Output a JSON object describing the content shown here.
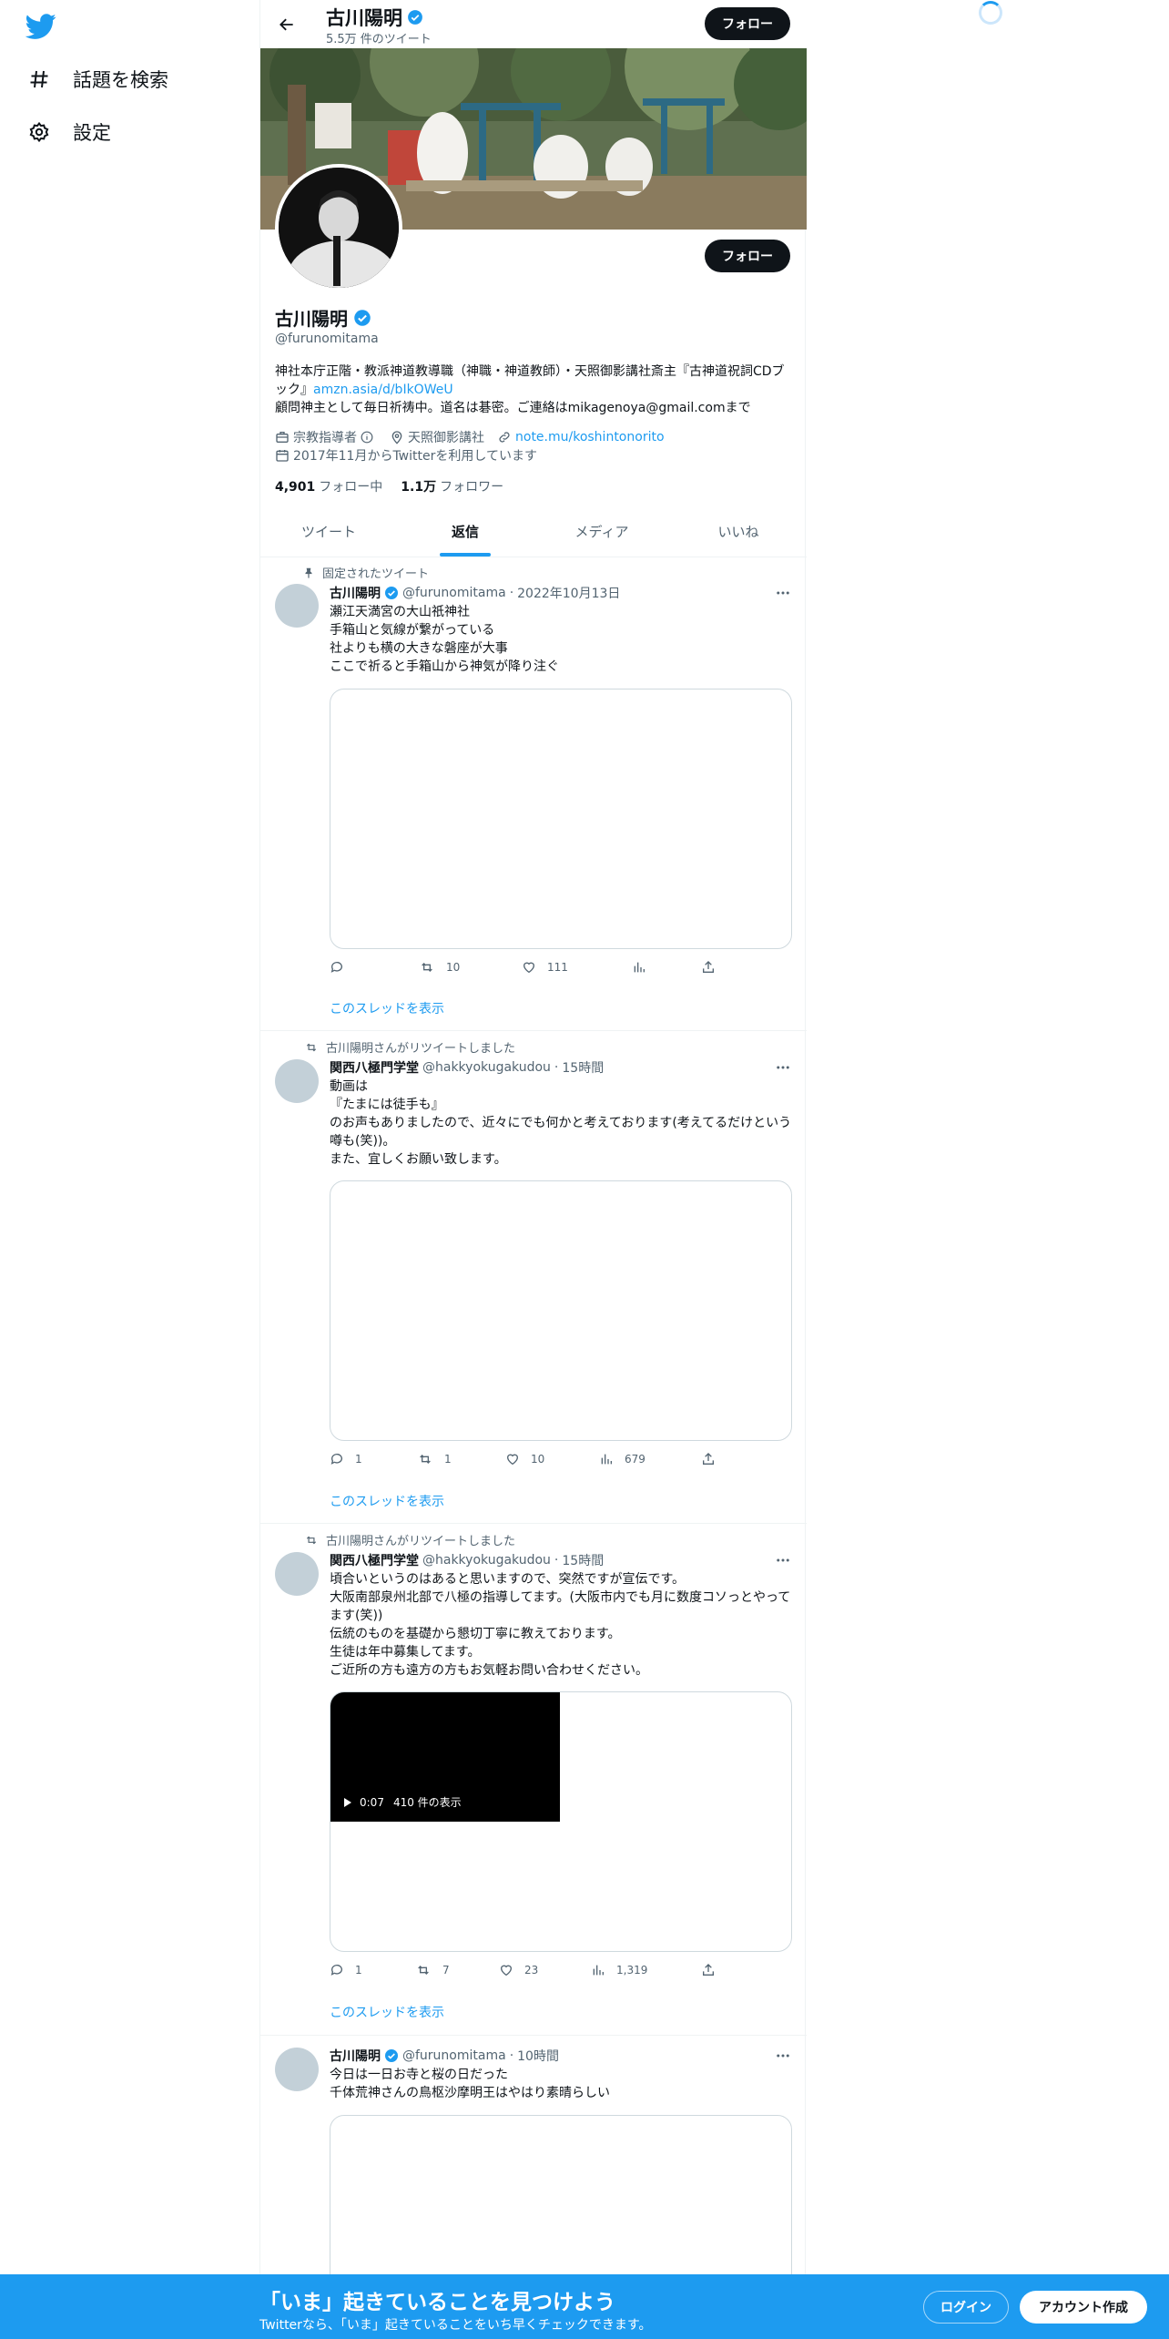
{
  "nav": {
    "items": [
      {
        "label": "話題を検索",
        "icon": "hashtag-icon"
      },
      {
        "label": "設定",
        "icon": "gear-icon"
      }
    ]
  },
  "header": {
    "name": "古川陽明",
    "tweet_count": "5.5万 件のツイート",
    "follow_label": "フォロー"
  },
  "profile": {
    "name": "古川陽明",
    "handle": "@furunomitama",
    "bio_line1": "神社本庁正階・教派神道教導職（神職・神道教師）・天照御影講社斎主『古神道祝詞CDブック』",
    "bio_link": "amzn.asia/d/bIkOWeU",
    "bio_line2": "顧問神主として毎日祈祷中。道名は碁密。ご連絡はmikagenoya@gmail.comまで",
    "category": "宗教指導者",
    "location": "天照御影講社",
    "website": "note.mu/koshintonorito",
    "joined": "2017年11月からTwitterを利用しています",
    "following_count": "4,901",
    "following_label": "フォロー中",
    "followers_count": "1.1万",
    "followers_label": "フォロワー",
    "follow_label": "フォロー"
  },
  "tabs": [
    "ツイート",
    "返信",
    "メディア",
    "いいね"
  ],
  "tweets": [
    {
      "context": "固定されたツイート",
      "name": "古川陽明",
      "handle": "@furunomitama",
      "time": "2022年10月13日",
      "text": "瀬江天満宮の大山祇神社\n手箱山と気線が繋がっている\n社よりも横の大きな磐座が大事\nここで祈ると手箱山から神気が降り注ぐ",
      "reply": "",
      "retweet": "10",
      "like": "111",
      "views": "",
      "thread": "このスレッドを表示"
    },
    {
      "context": "古川陽明さんがリツイートしました",
      "name": "関西八極門学堂",
      "handle": "@hakkyokugakudou",
      "time": "15時間",
      "text": "動画は\n『たまには徒手も』\nのお声もありましたので、近々にでも何かと考えております(考えてるだけという噂も(笑))。\nまた、宜しくお願い致します。",
      "reply": "1",
      "retweet": "1",
      "like": "10",
      "views": "679",
      "thread": "このスレッドを表示"
    },
    {
      "context": "古川陽明さんがリツイートしました",
      "name": "関西八極門学堂",
      "handle": "@hakkyokugakudou",
      "time": "15時間",
      "text": "頃合いというのはあると思いますので、突然ですが宣伝です。\n大阪南部泉州北部で八極の指導してます。(大阪市内でも月に数度コソっとやってます(笑))\n伝統のものを基礎から懇切丁寧に教えております。\n生徒は年中募集してます。\nご近所の方も遠方の方もお気軽お問い合わせください。",
      "video_time": "0:07",
      "video_views": "410 件の表示",
      "reply": "1",
      "retweet": "7",
      "like": "23",
      "views": "1,319",
      "thread": "このスレッドを表示"
    },
    {
      "name": "古川陽明",
      "handle": "@furunomitama",
      "time": "10時間",
      "text": "今日は一日お寺と桜の日だった\n千体荒神さんの鳥枢沙摩明王はやはり素晴らしい"
    }
  ],
  "bottom": {
    "title": "「いま」起きていることを見つけよう",
    "subtitle": "Twitterなら、「いま」起きていることをいち早くチェックできます。",
    "login": "ログイン",
    "signup": "アカウント作成"
  },
  "colors": {
    "accent": "#1d9bf0",
    "text": "#0f1419",
    "muted": "#536471"
  }
}
